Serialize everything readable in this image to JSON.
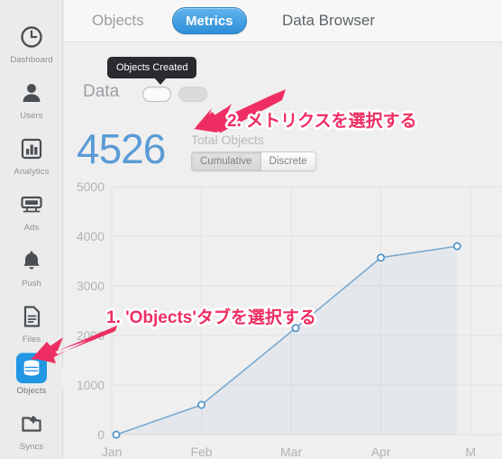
{
  "sidebar": {
    "items": [
      {
        "label": "Dashboard",
        "icon": "clock-icon",
        "active": false
      },
      {
        "label": "Users",
        "icon": "person-icon",
        "active": false
      },
      {
        "label": "Analytics",
        "icon": "bar-chart-icon",
        "active": false
      },
      {
        "label": "Ads",
        "icon": "billboard-icon",
        "active": false
      },
      {
        "label": "Push",
        "icon": "bell-icon",
        "active": false
      },
      {
        "label": "Files",
        "icon": "document-icon",
        "active": false
      },
      {
        "label": "Objects",
        "icon": "database-icon",
        "active": true
      },
      {
        "label": "Syncs",
        "icon": "folder-arrow-icon",
        "active": false
      }
    ]
  },
  "tabs": [
    {
      "label": "Objects",
      "active": false
    },
    {
      "label": "Metrics",
      "active": true
    },
    {
      "label": "Data Browser",
      "active": false
    }
  ],
  "panel": {
    "data_label": "Data",
    "tooltip": "Objects Created",
    "big_number": "4526",
    "metric_label": "Total Objects",
    "segments": [
      {
        "label": "Cumulative",
        "selected": true
      },
      {
        "label": "Discrete",
        "selected": false
      }
    ]
  },
  "annotations": [
    {
      "id": "step2",
      "text": "2. メトリクスを選択する"
    },
    {
      "id": "step1",
      "text": "1. 'Objects'タブを選択する"
    }
  ],
  "colors": {
    "accent_blue": "#2196e3",
    "number_blue": "#5b9bd5",
    "line_blue": "#7aa9d0",
    "annotation_pink": "#ee2e62",
    "tooltip_bg": "#292b2e",
    "sidebar_bg": "#ebebeb",
    "content_bg": "#efefef"
  },
  "chart_data": {
    "type": "line",
    "title": "",
    "xlabel": "",
    "ylabel": "",
    "categories": [
      "Jan",
      "Feb",
      "Mar",
      "Apr",
      "May"
    ],
    "xtick_labels": [
      "Jan",
      "Feb",
      "Mar",
      "Apr",
      "M"
    ],
    "ytick_labels": [
      "0",
      "1000",
      "2000",
      "3000",
      "4000",
      "5000"
    ],
    "ylim": [
      0,
      5000
    ],
    "grid": true,
    "legend": "none",
    "x": [
      0.05,
      1.0,
      2.05,
      3.0,
      3.85
    ],
    "values": [
      0,
      600,
      2150,
      3570,
      3800
    ],
    "series": [
      {
        "name": "Objects Created",
        "values": [
          0,
          600,
          2150,
          3570,
          3800
        ]
      }
    ],
    "marker": "open-circle",
    "line_color": "#7aa9d0",
    "fill": "rgba(140,180,215,0.10)"
  }
}
